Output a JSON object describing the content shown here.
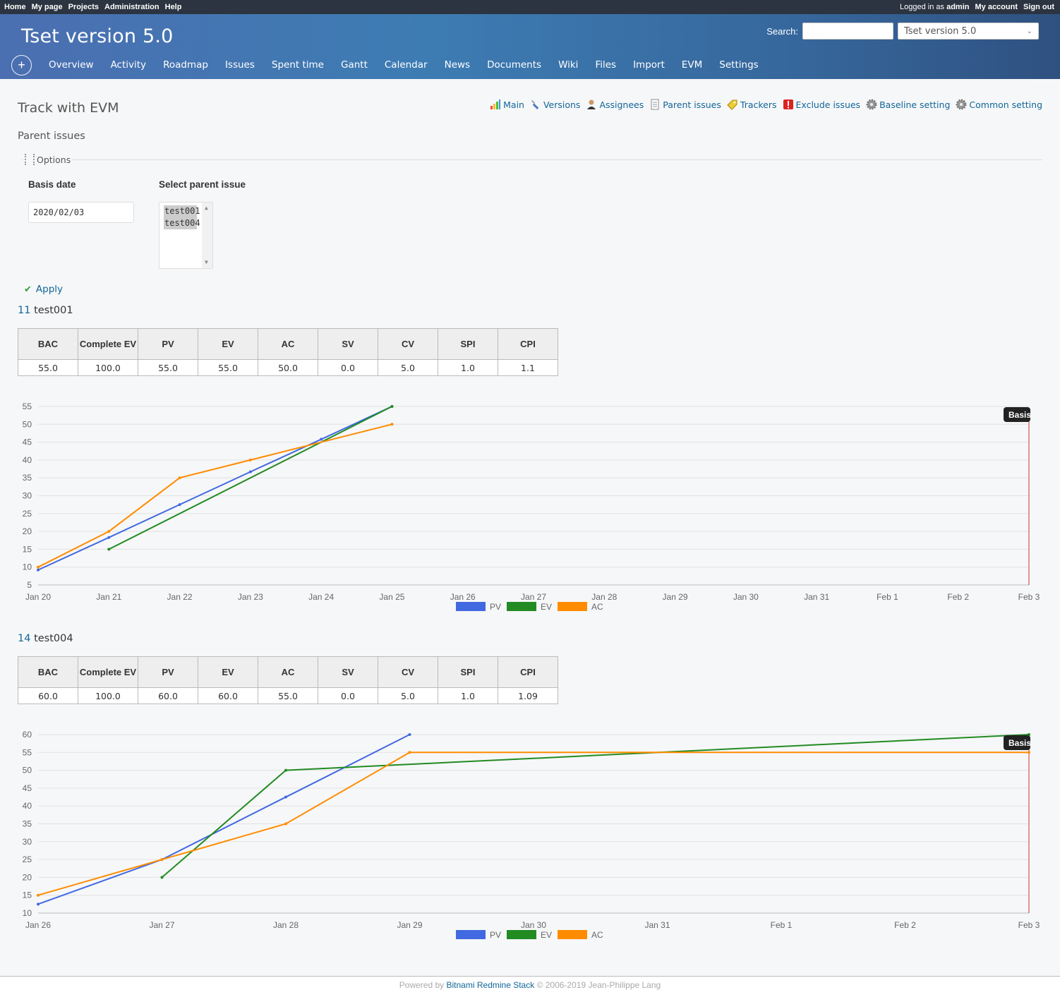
{
  "top_menu": {
    "left": [
      "Home",
      "My page",
      "Projects",
      "Administration",
      "Help"
    ],
    "logged_in_prefix": "Logged in as",
    "user": "admin",
    "right": [
      "My account",
      "Sign out"
    ]
  },
  "header": {
    "project_title": "Tset version 5.0",
    "search_label": "Search:",
    "project_select_value": "Tset version 5.0"
  },
  "main_menu": {
    "new_button": "+",
    "tabs": [
      "Overview",
      "Activity",
      "Roadmap",
      "Issues",
      "Spent time",
      "Gantt",
      "Calendar",
      "News",
      "Documents",
      "Wiki",
      "Files",
      "Import",
      "EVM",
      "Settings"
    ]
  },
  "contextual": {
    "links": [
      {
        "label": "Main",
        "icon": "chart-bars-icon"
      },
      {
        "label": "Versions",
        "icon": "wrench-icon"
      },
      {
        "label": "Assignees",
        "icon": "user-icon"
      },
      {
        "label": "Parent issues",
        "icon": "document-icon"
      },
      {
        "label": "Trackers",
        "icon": "tag-icon"
      },
      {
        "label": "Exclude issues",
        "icon": "exclamation-icon"
      },
      {
        "label": "Baseline setting",
        "icon": "gear-icon"
      },
      {
        "label": "Common setting",
        "icon": "gear-icon"
      }
    ]
  },
  "page": {
    "title": "Track with EVM",
    "subtitle": "Parent issues",
    "options_legend": "Options",
    "basis_date_label": "Basis date",
    "basis_date_value": "2020/02/03",
    "select_parent_label": "Select parent issue",
    "parent_options": [
      "test001",
      "test004"
    ],
    "apply_label": "Apply"
  },
  "issues": [
    {
      "id": "11",
      "name": "test001",
      "headers": [
        "BAC",
        "Complete EV",
        "PV",
        "EV",
        "AC",
        "SV",
        "CV",
        "SPI",
        "CPI"
      ],
      "values": [
        "55.0",
        "100.0",
        "55.0",
        "55.0",
        "50.0",
        "0.0",
        "5.0",
        "1.0",
        "1.1"
      ]
    },
    {
      "id": "14",
      "name": "test004",
      "headers": [
        "BAC",
        "Complete EV",
        "PV",
        "EV",
        "AC",
        "SV",
        "CV",
        "SPI",
        "CPI"
      ],
      "values": [
        "60.0",
        "100.0",
        "60.0",
        "60.0",
        "55.0",
        "0.0",
        "5.0",
        "1.0",
        "1.09"
      ]
    }
  ],
  "chart_data": [
    {
      "type": "line",
      "categories": [
        "Jan 20",
        "Jan 21",
        "Jan 22",
        "Jan 23",
        "Jan 24",
        "Jan 25",
        "Jan 26",
        "Jan 27",
        "Jan 28",
        "Jan 29",
        "Jan 30",
        "Jan 31",
        "Feb 1",
        "Feb 2",
        "Feb 3"
      ],
      "ylim": [
        5,
        55
      ],
      "yticks": [
        5,
        10,
        15,
        20,
        25,
        30,
        35,
        40,
        45,
        50,
        55
      ],
      "grid": true,
      "legend_position": "bottom",
      "basis_label": "Basis",
      "basis_index": 14,
      "series": [
        {
          "name": "PV",
          "color": "#4169e1",
          "points": [
            [
              0,
              9.2
            ],
            [
              1,
              18.3
            ],
            [
              2,
              27.5
            ],
            [
              3,
              36.7
            ],
            [
              4,
              45.8
            ],
            [
              5,
              55
            ]
          ]
        },
        {
          "name": "EV",
          "color": "#228b22",
          "points": [
            [
              1,
              15
            ],
            [
              5,
              55
            ]
          ]
        },
        {
          "name": "AC",
          "color": "#ff8c00",
          "points": [
            [
              0,
              10
            ],
            [
              1,
              20
            ],
            [
              2,
              35
            ],
            [
              3,
              40
            ],
            [
              5,
              50
            ]
          ]
        }
      ]
    },
    {
      "type": "line",
      "categories": [
        "Jan 26",
        "Jan 27",
        "Jan 28",
        "Jan 29",
        "Jan 30",
        "Jan 31",
        "Feb 1",
        "Feb 2",
        "Feb 3"
      ],
      "ylim": [
        10,
        60
      ],
      "yticks": [
        10,
        15,
        20,
        25,
        30,
        35,
        40,
        45,
        50,
        55,
        60
      ],
      "grid": true,
      "legend_position": "bottom",
      "basis_label": "Basis",
      "basis_index": 8,
      "series": [
        {
          "name": "PV",
          "color": "#4169e1",
          "points": [
            [
              0,
              12.5
            ],
            [
              1,
              25
            ],
            [
              2,
              42.5
            ],
            [
              3,
              60
            ]
          ]
        },
        {
          "name": "EV",
          "color": "#228b22",
          "points": [
            [
              1,
              20
            ],
            [
              2,
              50
            ],
            [
              8,
              60
            ]
          ]
        },
        {
          "name": "AC",
          "color": "#ff8c00",
          "points": [
            [
              0,
              15
            ],
            [
              1,
              25
            ],
            [
              2,
              35
            ],
            [
              3,
              55
            ],
            [
              8,
              55
            ]
          ]
        }
      ]
    }
  ],
  "footer": {
    "prefix": "Powered by",
    "link": "Bitnami Redmine Stack",
    "suffix": "© 2006-2019 Jean-Philippe Lang"
  }
}
